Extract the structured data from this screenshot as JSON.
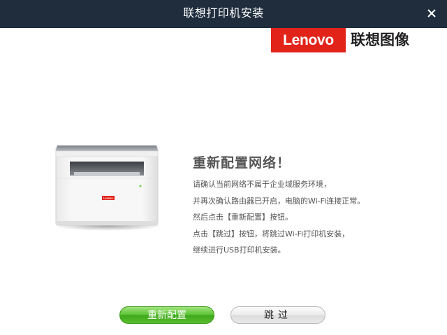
{
  "window": {
    "title": "联想打印机安装",
    "close_icon": "close-icon"
  },
  "brand": {
    "logo_text": "Lenovo",
    "logo_suffix": "联想图像",
    "logo_color": "#e2231a"
  },
  "printer": {
    "image": "printer-illustration",
    "label": "Lenovo"
  },
  "message": {
    "heading": "重新配置网络！",
    "lines": [
      "请确认当前网络不属于企业域服务环境，",
      "并再次确认路由器已开启，电脑的Wi-Fi连接正常。",
      "然后点击【重新配置】按钮。",
      "点击【跳过】按钮，将跳过Wi-Fi打印机安装，",
      "继续进行USB打印机安装。"
    ]
  },
  "buttons": {
    "reconfigure": "重新配置",
    "skip": "跳过"
  },
  "colors": {
    "titlebar": "#1f2d3d",
    "primary_button": "#5cc236",
    "secondary_button": "#e6e6e6"
  }
}
